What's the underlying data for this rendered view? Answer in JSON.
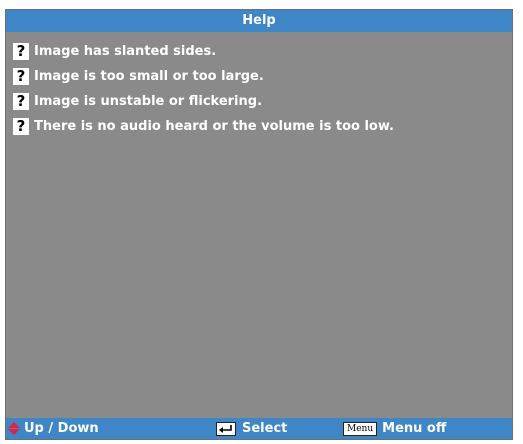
{
  "title": "Help",
  "items": [
    {
      "icon": "question-icon",
      "label": "Image has slanted sides."
    },
    {
      "icon": "question-icon",
      "label": "Image is too small or too large."
    },
    {
      "icon": "question-icon",
      "label": "Image is unstable or flickering."
    },
    {
      "icon": "question-icon",
      "label": "There is no audio heard or the volume is too low."
    }
  ],
  "footer": {
    "updown_label": "Up / Down",
    "select_label": "Select",
    "menu_key": "Menu",
    "menuoff_label": "Menu off"
  },
  "colors": {
    "panel": "#8a8a8a",
    "bar": "#3e86c6",
    "arrow": "#e0243a"
  }
}
